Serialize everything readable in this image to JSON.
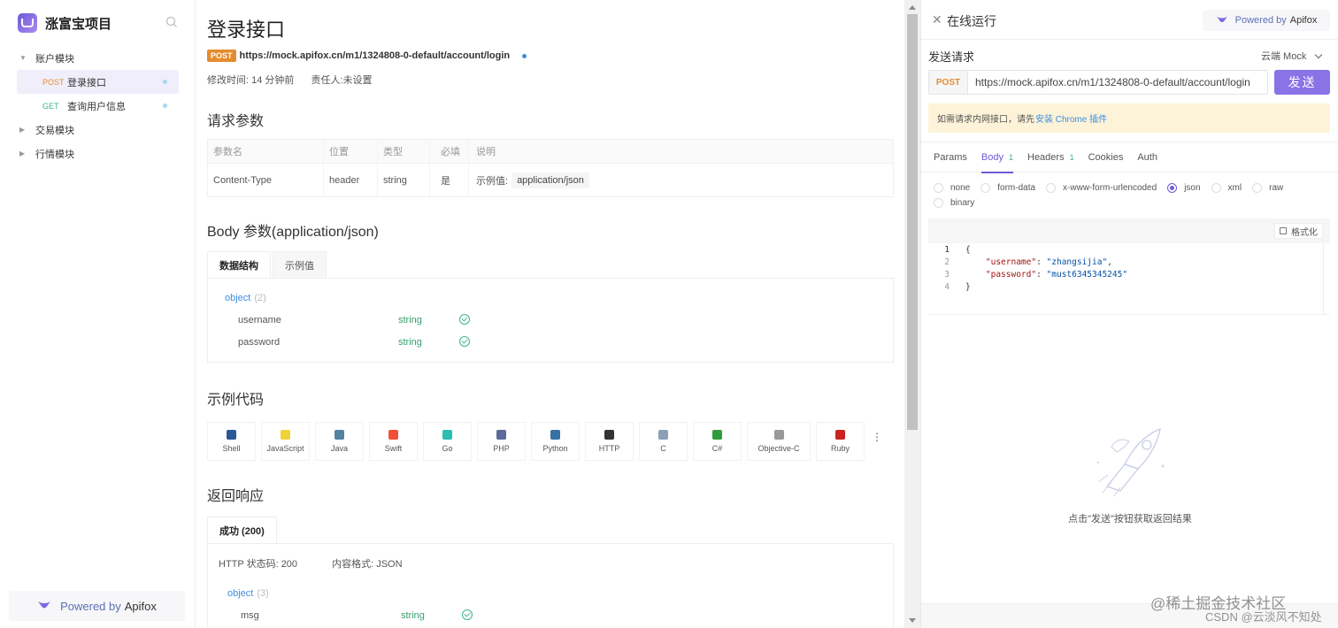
{
  "sidebar": {
    "project_name": "涨富宝项目",
    "tree": [
      {
        "type": "folder",
        "label": "账户模块",
        "expanded": true
      },
      {
        "type": "api",
        "method": "POST",
        "label": "登录接口",
        "active": true
      },
      {
        "type": "api",
        "method": "GET",
        "label": "查询用户信息",
        "active": false
      },
      {
        "type": "folder",
        "label": "交易模块",
        "expanded": false
      },
      {
        "type": "folder",
        "label": "行情模块",
        "expanded": false
      }
    ],
    "footer_prefix": "Powered by",
    "footer_brand": "Apifox"
  },
  "main": {
    "title": "登录接口",
    "method": "POST",
    "url": "https://mock.apifox.cn/m1/1324808-0-default/account/login",
    "modified": "修改时间: 14 分钟前",
    "owner": "责任人:未设置",
    "request_params_title": "请求参数",
    "params_headers": [
      "参数名",
      "位置",
      "类型",
      "必填",
      "说明"
    ],
    "params_rows": [
      {
        "name": "Content-Type",
        "location": "header",
        "type": "string",
        "required": "是",
        "desc_prefix": "示例值:",
        "example": "application/json"
      }
    ],
    "body_title": "Body 参数(application/json)",
    "body_tabs": [
      "数据结构",
      "示例值"
    ],
    "body_schema": {
      "object_label": "object",
      "object_count": "(2)",
      "fields": [
        {
          "name": "username",
          "type": "string"
        },
        {
          "name": "password",
          "type": "string"
        }
      ]
    },
    "sample_code_title": "示例代码",
    "languages": [
      {
        "name": "Shell",
        "icon": "shell-icon",
        "color": "#2b5797"
      },
      {
        "name": "JavaScript",
        "icon": "javascript-icon",
        "color": "#f0d33a"
      },
      {
        "name": "Java",
        "icon": "java-icon",
        "color": "#5382a1"
      },
      {
        "name": "Swift",
        "icon": "swift-icon",
        "color": "#f05138"
      },
      {
        "name": "Go",
        "icon": "go-icon",
        "color": "#29beb0"
      },
      {
        "name": "PHP",
        "icon": "php-icon",
        "color": "#5a6b9b"
      },
      {
        "name": "Python",
        "icon": "python-icon",
        "color": "#3772a4"
      },
      {
        "name": "HTTP",
        "icon": "http-icon",
        "color": "#333333"
      },
      {
        "name": "C",
        "icon": "c-icon",
        "color": "#8aa0b8"
      },
      {
        "name": "C#",
        "icon": "csharp-icon",
        "color": "#2e9e3a"
      },
      {
        "name": "Objective-C",
        "icon": "objective-c-icon",
        "color": "#999999"
      },
      {
        "name": "Ruby",
        "icon": "ruby-icon",
        "color": "#cc2222"
      }
    ],
    "response_title": "返回响应",
    "response_tab": "成功 (200)",
    "response_status": "HTTP 状态码: 200",
    "response_format": "内容格式: JSON",
    "response_schema": {
      "object_label": "object",
      "object_count": "(3)",
      "fields": [
        {
          "name": "msg",
          "type": "string"
        }
      ]
    }
  },
  "runner": {
    "title": "在线运行",
    "powered_prefix": "Powered by",
    "powered_brand": "Apifox",
    "send_request_label": "发送请求",
    "environment": "云端 Mock",
    "method": "POST",
    "url": "https://mock.apifox.cn/m1/1324808-0-default/account/login",
    "send_button": "发送",
    "notice_text": "如需请求内网接口，请先",
    "notice_link": "安装 Chrome 插件",
    "tabs": [
      {
        "label": "Params",
        "count": ""
      },
      {
        "label": "Body",
        "count": "1"
      },
      {
        "label": "Headers",
        "count": "1"
      },
      {
        "label": "Cookies",
        "count": ""
      },
      {
        "label": "Auth",
        "count": ""
      }
    ],
    "body_types": [
      "none",
      "form-data",
      "x-www-form-urlencoded",
      "json",
      "xml",
      "raw",
      "binary"
    ],
    "body_type_selected": "json",
    "format_button": "格式化",
    "code_lines": [
      "{",
      "    \"username\": \"zhangsijia\",",
      "    \"password\": \"must6345345245\"",
      "}"
    ],
    "empty_result_text": "点击\"发送\"按钮获取返回结果"
  },
  "watermark": {
    "line1": "@稀土掘金技术社区",
    "line2": "CSDN @云淡风不知处"
  },
  "colors": {
    "accent": "#8a73e6",
    "post": "#e58c2e",
    "get": "#3bb58c",
    "link": "#3e8ee0"
  }
}
